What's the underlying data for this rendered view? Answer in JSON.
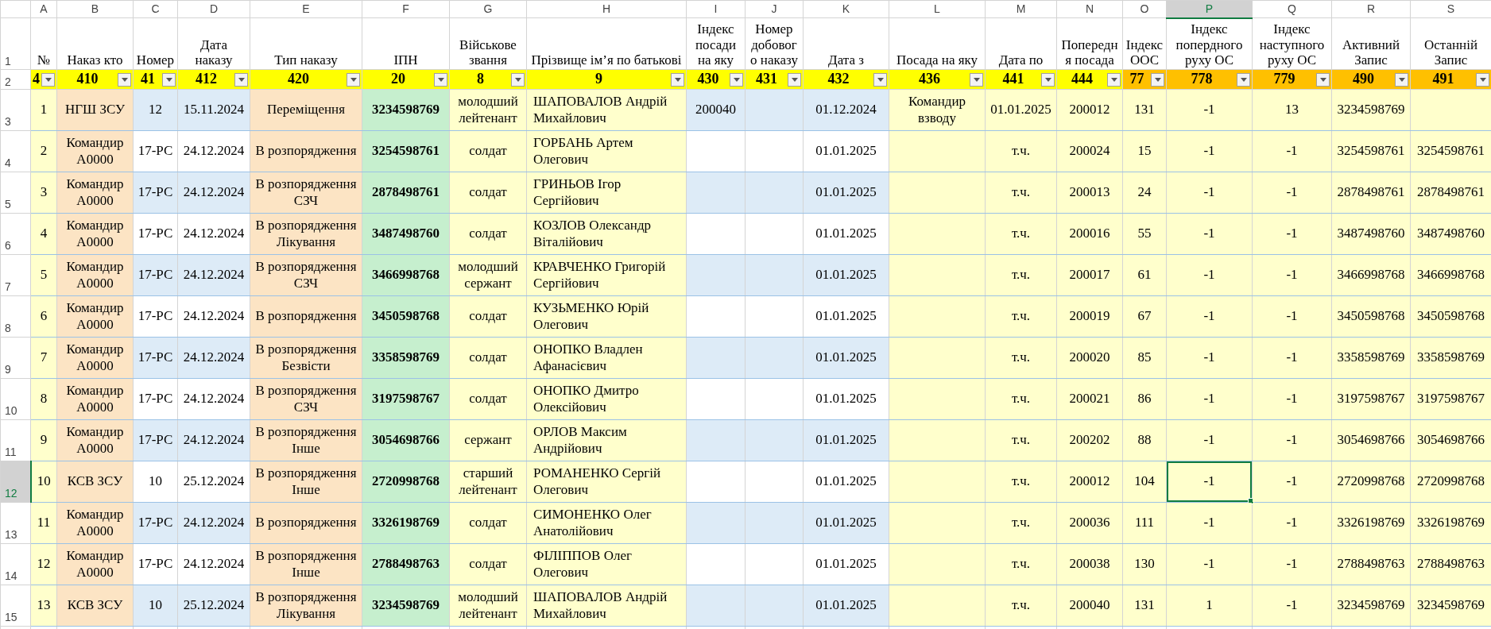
{
  "column_letters": [
    {
      "letter": "A",
      "selected": false
    },
    {
      "letter": "B",
      "selected": false
    },
    {
      "letter": "C",
      "selected": false
    },
    {
      "letter": "D",
      "selected": false
    },
    {
      "letter": "E",
      "selected": false
    },
    {
      "letter": "F",
      "selected": false
    },
    {
      "letter": "G",
      "selected": false
    },
    {
      "letter": "H",
      "selected": false
    },
    {
      "letter": "I",
      "selected": false
    },
    {
      "letter": "J",
      "selected": false
    },
    {
      "letter": "K",
      "selected": false
    },
    {
      "letter": "L",
      "selected": false
    },
    {
      "letter": "M",
      "selected": false
    },
    {
      "letter": "N",
      "selected": false
    },
    {
      "letter": "O",
      "selected": false
    },
    {
      "letter": "P",
      "selected": true
    },
    {
      "letter": "Q",
      "selected": false
    },
    {
      "letter": "R",
      "selected": false
    },
    {
      "letter": "S",
      "selected": false
    }
  ],
  "header_row": {
    "num": "1",
    "selected": false,
    "cells": [
      "№",
      "Наказ кто",
      "Номер",
      "Дата наказу",
      "Тип наказу",
      "ІПН",
      "Військове звання",
      "Прізвище імʼя по батькові",
      "Індекс посади на яку",
      "Номер добовог о наказу",
      "Дата з",
      "Посада на яку",
      "Дата по",
      "Попередн я посада",
      "Індекс ООС",
      "Індекс попердного руху ОС",
      "Індекс наступного руху ОС",
      "Активний Запис",
      "Останній Запис"
    ]
  },
  "filter_row": {
    "num": "2",
    "selected": false,
    "cells": [
      {
        "value": "4",
        "color": "#ffff00"
      },
      {
        "value": "410",
        "color": "#ffff00"
      },
      {
        "value": "41",
        "color": "#ffff00"
      },
      {
        "value": "412",
        "color": "#ffff00"
      },
      {
        "value": "420",
        "color": "#ffff00"
      },
      {
        "value": "20",
        "color": "#ffff00"
      },
      {
        "value": "8",
        "color": "#ffff00"
      },
      {
        "value": "9",
        "color": "#ffff00"
      },
      {
        "value": "430",
        "color": "#ffff00"
      },
      {
        "value": "431",
        "color": "#ffff00"
      },
      {
        "value": "432",
        "color": "#ffff00"
      },
      {
        "value": "436",
        "color": "#ffff00"
      },
      {
        "value": "441",
        "color": "#ffff00"
      },
      {
        "value": "444",
        "color": "#ffff00"
      },
      {
        "value": "77",
        "color": "#ffc000"
      },
      {
        "value": "778",
        "color": "#ffc000"
      },
      {
        "value": "779",
        "color": "#ffc000"
      },
      {
        "value": "490",
        "color": "#ffc000"
      },
      {
        "value": "491",
        "color": "#ffc000"
      }
    ]
  },
  "rows": [
    {
      "num": "3",
      "selected": false,
      "cells": [
        "1",
        "НГШ ЗСУ",
        "12",
        "15.11.2024",
        "Переміщення",
        "3234598769",
        "молодший лейтенант",
        "ШАПОВАЛОВ Андрій Михайлович",
        "200040",
        null,
        "01.12.2024",
        "Командир взводу",
        "01.01.2025",
        "200012",
        "131",
        "-1",
        "13",
        "3234598769",
        null
      ]
    },
    {
      "num": "4",
      "selected": false,
      "cells": [
        "2",
        "Командир А0000",
        "17-РС",
        "24.12.2024",
        "В розпорядження",
        "3254598761",
        "солдат",
        "ГОРБАНЬ Артем Олегович",
        null,
        null,
        "01.01.2025",
        null,
        "т.ч.",
        "200024",
        "15",
        "-1",
        "-1",
        "3254598761",
        "3254598761"
      ]
    },
    {
      "num": "5",
      "selected": false,
      "cells": [
        "3",
        "Командир А0000",
        "17-РС",
        "24.12.2024",
        "В розпорядження СЗЧ",
        "2878498761",
        "солдат",
        "ГРИНЬОВ Ігор Сергійович",
        null,
        null,
        "01.01.2025",
        null,
        "т.ч.",
        "200013",
        "24",
        "-1",
        "-1",
        "2878498761",
        "2878498761"
      ]
    },
    {
      "num": "6",
      "selected": false,
      "cells": [
        "4",
        "Командир А0000",
        "17-РС",
        "24.12.2024",
        "В розпорядження Лікування",
        "3487498760",
        "солдат",
        "КОЗЛОВ Олександр Віталійович",
        null,
        null,
        "01.01.2025",
        null,
        "т.ч.",
        "200016",
        "55",
        "-1",
        "-1",
        "3487498760",
        "3487498760"
      ]
    },
    {
      "num": "7",
      "selected": false,
      "cells": [
        "5",
        "Командир А0000",
        "17-РС",
        "24.12.2024",
        "В розпорядження СЗЧ",
        "3466998768",
        "молодший сержант",
        "КРАВЧЕНКО Григорій Сергійович",
        null,
        null,
        "01.01.2025",
        null,
        "т.ч.",
        "200017",
        "61",
        "-1",
        "-1",
        "3466998768",
        "3466998768"
      ]
    },
    {
      "num": "8",
      "selected": false,
      "cells": [
        "6",
        "Командир А0000",
        "17-РС",
        "24.12.2024",
        "В розпорядження",
        "3450598768",
        "солдат",
        "КУЗЬМЕНКО Юрій Олегович",
        null,
        null,
        "01.01.2025",
        null,
        "т.ч.",
        "200019",
        "67",
        "-1",
        "-1",
        "3450598768",
        "3450598768"
      ]
    },
    {
      "num": "9",
      "selected": false,
      "cells": [
        "7",
        "Командир А0000",
        "17-РС",
        "24.12.2024",
        "В розпорядження Безвісти",
        "3358598769",
        "солдат",
        "ОНОПКО Владлен Афанасієвич",
        null,
        null,
        "01.01.2025",
        null,
        "т.ч.",
        "200020",
        "85",
        "-1",
        "-1",
        "3358598769",
        "3358598769"
      ]
    },
    {
      "num": "10",
      "selected": false,
      "cells": [
        "8",
        "Командир А0000",
        "17-РС",
        "24.12.2024",
        "В розпорядження СЗЧ",
        "3197598767",
        "солдат",
        "ОНОПКО Дмитро Олексійович",
        null,
        null,
        "01.01.2025",
        null,
        "т.ч.",
        "200021",
        "86",
        "-1",
        "-1",
        "3197598767",
        "3197598767"
      ]
    },
    {
      "num": "11",
      "selected": false,
      "cells": [
        "9",
        "Командир А0000",
        "17-РС",
        "24.12.2024",
        "В розпорядження Інше",
        "3054698766",
        "сержант",
        "ОРЛОВ Максим Андрійович",
        null,
        null,
        "01.01.2025",
        null,
        "т.ч.",
        "200202",
        "88",
        "-1",
        "-1",
        "3054698766",
        "3054698766"
      ]
    },
    {
      "num": "12",
      "selected": true,
      "cells": [
        "10",
        "КСВ ЗСУ",
        "10",
        "25.12.2024",
        "В розпорядження Інше",
        "2720998768",
        "старший лейтенант",
        "РОМАНЕНКО Сергій Олегович",
        null,
        null,
        "01.01.2025",
        null,
        "т.ч.",
        "200012",
        "104",
        "-1",
        "-1",
        "2720998768",
        "2720998768"
      ]
    },
    {
      "num": "13",
      "selected": false,
      "cells": [
        "11",
        "Командир А0000",
        "17-РС",
        "24.12.2024",
        "В розпорядження",
        "3326198769",
        "солдат",
        "СИМОНЕНКО Олег Анатолійович",
        null,
        null,
        "01.01.2025",
        null,
        "т.ч.",
        "200036",
        "111",
        "-1",
        "-1",
        "3326198769",
        "3326198769"
      ]
    },
    {
      "num": "14",
      "selected": false,
      "cells": [
        "12",
        "Командир А0000",
        "17-РС",
        "24.12.2024",
        "В розпорядження Інше",
        "2788498763",
        "солдат",
        "ФІЛІППОВ Олег Олегович",
        null,
        null,
        "01.01.2025",
        null,
        "т.ч.",
        "200038",
        "130",
        "-1",
        "-1",
        "2788498763",
        "2788498763"
      ]
    },
    {
      "num": "15",
      "selected": false,
      "cells": [
        "13",
        "КСВ ЗСУ",
        "10",
        "25.12.2024",
        "В розпорядження Лікування",
        "3234598769",
        "молодший лейтенант",
        "ШАПОВАЛОВ Андрій Михайлович",
        null,
        null,
        "01.01.2025",
        null,
        "т.ч.",
        "200040",
        "131",
        "1",
        "-1",
        "3234598769",
        "3234598769"
      ]
    }
  ]
}
